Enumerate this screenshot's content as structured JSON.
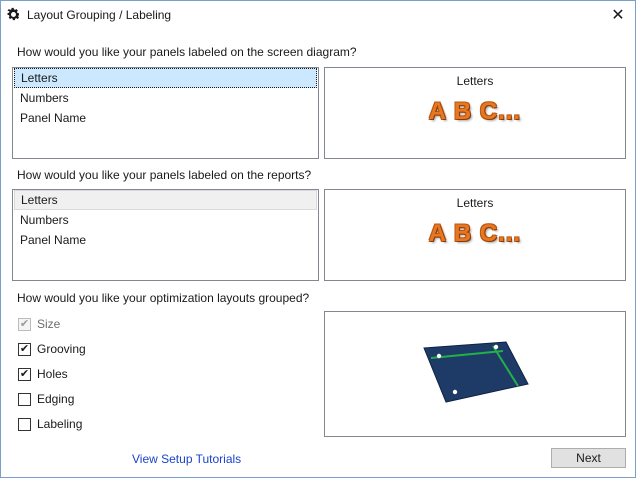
{
  "window": {
    "title": "Layout Grouping / Labeling",
    "close_symbol": "✕"
  },
  "screen_labels": {
    "question": "How would you like your panels labeled on the screen diagram?",
    "options": [
      "Letters",
      "Numbers",
      "Panel Name"
    ],
    "selected": "Letters",
    "preview_title": "Letters",
    "preview_sample": "A B C..."
  },
  "report_labels": {
    "question": "How would you like your panels labeled on the reports?",
    "options": [
      "Letters",
      "Numbers",
      "Panel Name"
    ],
    "selected": "Letters",
    "preview_title": "Letters",
    "preview_sample": "A B C..."
  },
  "grouping": {
    "question": "How would you like your optimization layouts grouped?",
    "options": [
      {
        "label": "Size",
        "checked": true,
        "disabled": true
      },
      {
        "label": "Grooving",
        "checked": true,
        "disabled": false
      },
      {
        "label": "Holes",
        "checked": true,
        "disabled": false
      },
      {
        "label": "Edging",
        "checked": false,
        "disabled": false
      },
      {
        "label": "Labeling",
        "checked": false,
        "disabled": false
      }
    ]
  },
  "footer": {
    "tutorials_link": "View Setup Tutorials",
    "next_button": "Next"
  },
  "colors": {
    "selection": "#cce8ff",
    "link": "#1a44c8",
    "sample_text": "#e87722",
    "panel_fill": "#1e3a66",
    "groove_line": "#22b04a"
  },
  "icons": {
    "title_icon": "gear-icon",
    "close": "close-icon",
    "check": "checkmark-icon"
  }
}
